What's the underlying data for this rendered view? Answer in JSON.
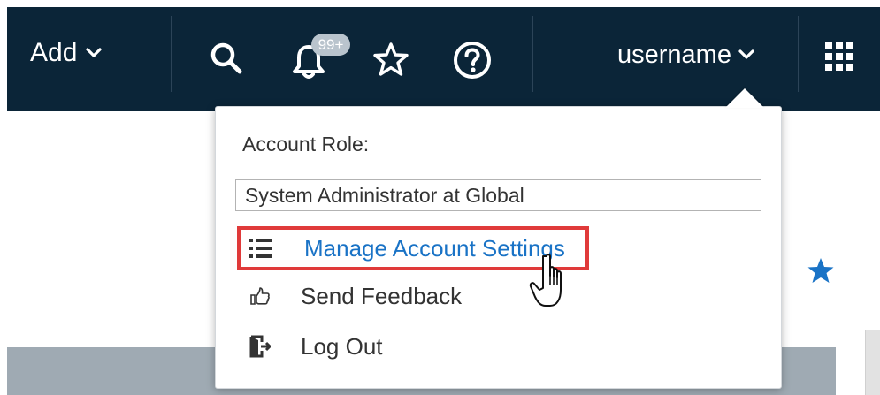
{
  "topbar": {
    "add_label": "Add",
    "notification_badge": "99+",
    "username": "username",
    "icons": {
      "add_dropdown": "chevron-down-icon",
      "search": "search-icon",
      "notifications": "bell-icon",
      "favorites": "star-outline-icon",
      "help": "help-icon",
      "user_dropdown": "chevron-down-icon",
      "apps": "apps-grid-icon"
    }
  },
  "dropdown": {
    "account_role_label": "Account Role:",
    "selected_role": "System Administrator at Global",
    "items": [
      {
        "label": "Manage Account Settings",
        "icon": "list-icon",
        "highlighted": true
      },
      {
        "label": "Send Feedback",
        "icon": "thumbs-up-icon",
        "highlighted": false
      },
      {
        "label": "Log Out",
        "icon": "logout-icon",
        "highlighted": false
      }
    ]
  },
  "page": {
    "favorite_icon": "star-filled-icon"
  },
  "colors": {
    "topbar_bg": "#0b2538",
    "link_blue": "#1a73c6",
    "highlight_red": "#e03a3a",
    "badge_bg": "#b9c4cd",
    "favorite_star": "#1a73c6"
  }
}
